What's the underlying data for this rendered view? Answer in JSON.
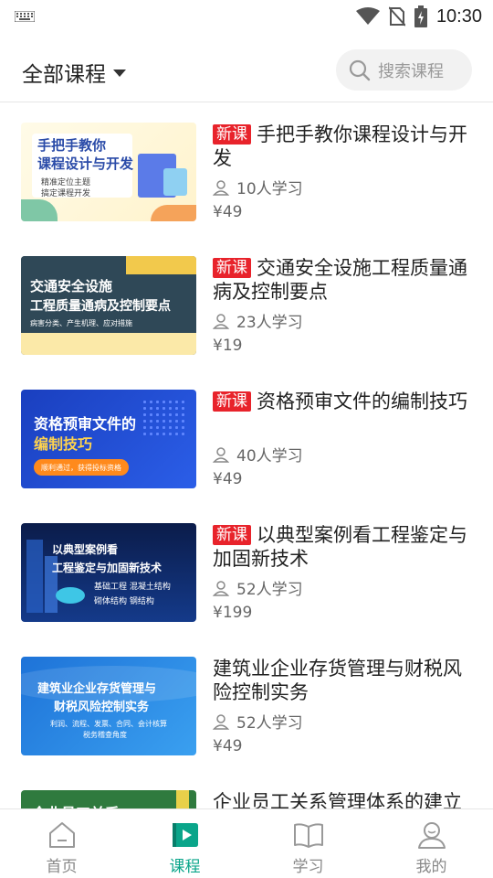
{
  "status_bar": {
    "time": "10:30"
  },
  "header": {
    "title": "全部课程",
    "search_placeholder": "搜索课程"
  },
  "courses": [
    {
      "tag": "新课",
      "title": "手把手教你课程设计与开发",
      "learners": "10人学习",
      "price": "¥49",
      "thumb": {
        "line1": "手把手教你",
        "line2": "课程设计与开发",
        "line3": "精准定位主题",
        "line4": "搞定课程开发"
      }
    },
    {
      "tag": "新课",
      "title": "交通安全设施工程质量通病及控制要点",
      "learners": "23人学习",
      "price": "¥19",
      "thumb": {
        "line1": "交通安全设施",
        "line2": "工程质量通病及控制要点",
        "line3": "病害分类、产生机理、应对措施"
      }
    },
    {
      "tag": "新课",
      "title": "资格预审文件的编制技巧",
      "learners": "40人学习",
      "price": "¥49",
      "thumb": {
        "line1": "资格预审文件的",
        "line2": "编制技巧",
        "line3": "顺利通过，获得投标资格"
      }
    },
    {
      "tag": "新课",
      "title": "以典型案例看工程鉴定与加固新技术",
      "learners": "52人学习",
      "price": "¥199",
      "thumb": {
        "line1": "以典型案例看",
        "line2": "工程鉴定与加固新技术",
        "line3": "基础工程  混凝土结构",
        "line4": "砌体结构  钢结构"
      }
    },
    {
      "tag": "",
      "title": "建筑业企业存货管理与财税风险控制实务",
      "learners": "52人学习",
      "price": "¥49",
      "thumb": {
        "line1": "建筑业企业存货管理与",
        "line2": "财税风险控制实务",
        "line3": "利润、流程、发票、合同、会计核算",
        "line4": "税务稽查角度"
      }
    },
    {
      "tag": "",
      "title": "企业员工关系管理体系的建立",
      "learners": "",
      "price": "",
      "thumb": {
        "line1": "企业员工关系"
      }
    }
  ],
  "tabs": [
    {
      "label": "首页",
      "icon": "home-icon"
    },
    {
      "label": "课程",
      "icon": "course-play-icon"
    },
    {
      "label": "学习",
      "icon": "book-icon"
    },
    {
      "label": "我的",
      "icon": "profile-icon"
    }
  ],
  "colors": {
    "accent": "#0aa58a",
    "tag_red": "#e8232b"
  }
}
